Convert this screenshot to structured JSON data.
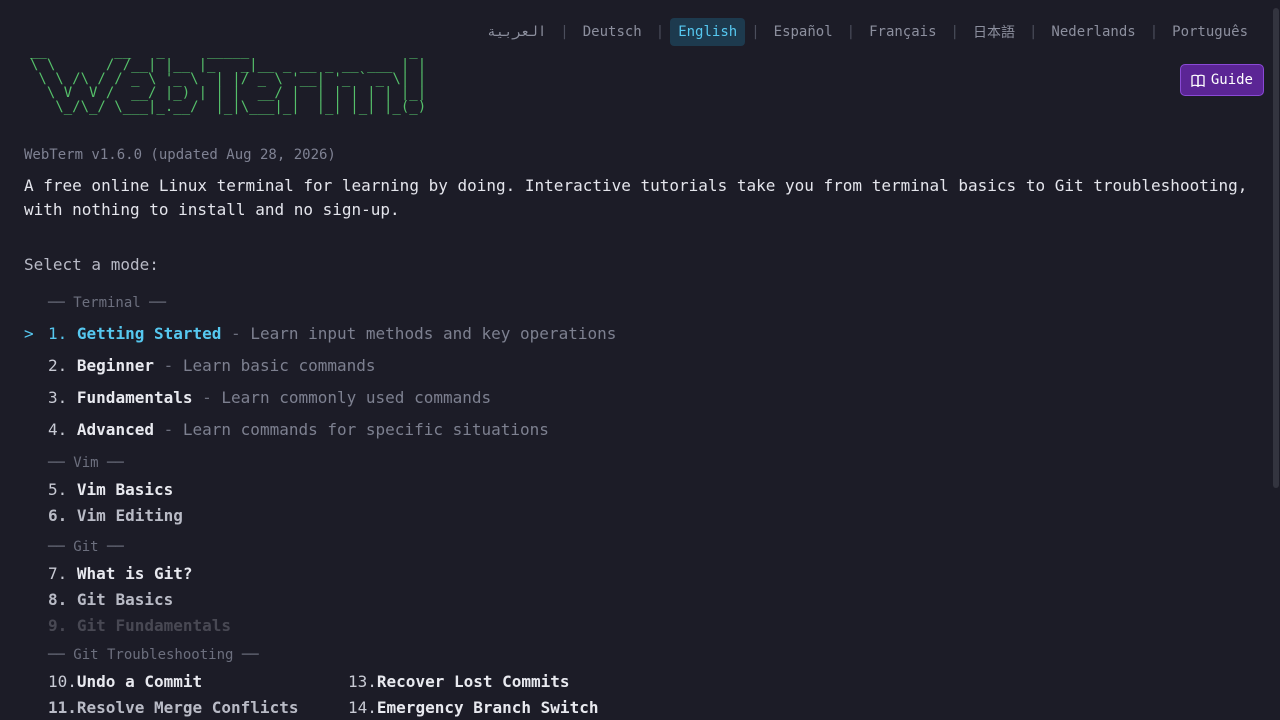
{
  "languages": [
    {
      "label": "العربية",
      "active": false
    },
    {
      "label": "Deutsch",
      "active": false
    },
    {
      "label": "English",
      "active": true
    },
    {
      "label": "Español",
      "active": false
    },
    {
      "label": "Français",
      "active": false
    },
    {
      "label": "日本語",
      "active": false
    },
    {
      "label": "Nederlands",
      "active": false
    },
    {
      "label": "Português",
      "active": false
    }
  ],
  "guide": {
    "label": "Guide",
    "icon": "book-icon"
  },
  "logo_text": "WebTerm",
  "version": "WebTerm v1.6.0 (updated Aug 28, 2026)",
  "description": "A free online Linux terminal for learning by doing. Interactive tutorials take you from terminal basics to Git troubleshooting, with nothing to install and no sign-up.",
  "select_mode": "Select a mode:",
  "cursor": ">",
  "sections": {
    "terminal": "── Terminal ──",
    "vim": "── Vim ──",
    "git": "── Git ──",
    "git_troubleshooting": "── Git Troubleshooting ──"
  },
  "items": {
    "i1": {
      "num": "1.",
      "name": "Getting Started",
      "sub": "Learn input methods and key operations"
    },
    "i2": {
      "num": "2.",
      "name": "Beginner",
      "sub": "Learn basic commands"
    },
    "i3": {
      "num": "3.",
      "name": "Fundamentals",
      "sub": "Learn commonly used commands"
    },
    "i4": {
      "num": "4.",
      "name": "Advanced",
      "sub": "Learn commands for specific situations"
    },
    "i5": {
      "num": "5.",
      "name": "Vim Basics"
    },
    "i6": {
      "num": "6.",
      "name": "Vim Editing"
    },
    "i7": {
      "num": "7.",
      "name": "What is Git?"
    },
    "i8": {
      "num": "8.",
      "name": "Git Basics"
    },
    "i9": {
      "num": "9.",
      "name": "Git Fundamentals"
    },
    "i10": {
      "num": "10.",
      "name": "Undo a Commit"
    },
    "i11": {
      "num": "11.",
      "name": "Resolve Merge Conflicts"
    },
    "i13": {
      "num": "13.",
      "name": "Recover Lost Commits"
    },
    "i14": {
      "num": "14.",
      "name": "Emergency Branch Switch"
    }
  },
  "dash": " - ",
  "colors": {
    "accent": "#56c8f0",
    "logo": "#55c06a",
    "guide": "#5b2595",
    "background": "#1c1c27"
  }
}
